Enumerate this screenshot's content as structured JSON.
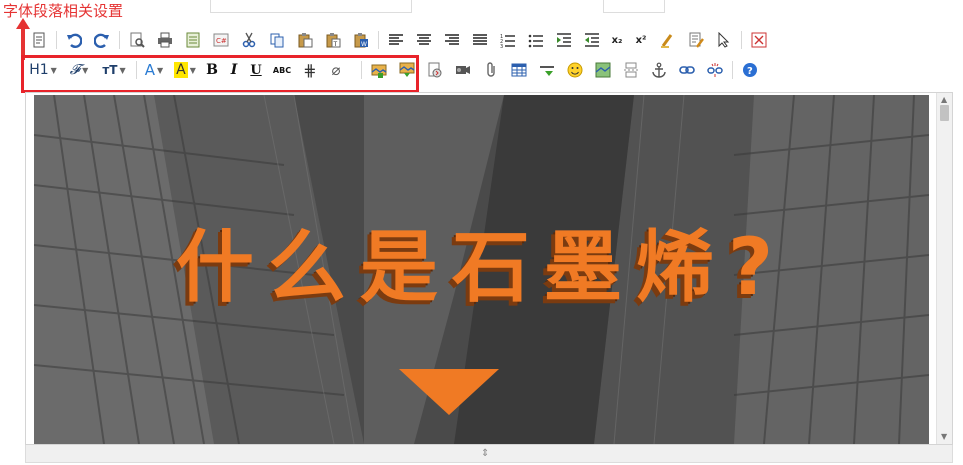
{
  "annotation": {
    "label": "字体段落相关设置",
    "color": "#e53333"
  },
  "toolbar": {
    "row1": [
      {
        "name": "source-icon",
        "title": "源代码"
      },
      {
        "name": "undo-icon",
        "title": "撤销"
      },
      {
        "name": "redo-icon",
        "title": "重做"
      },
      {
        "name": "preview-icon",
        "title": "预览"
      },
      {
        "name": "print-icon",
        "title": "打印"
      },
      {
        "name": "template-icon",
        "title": "模板"
      },
      {
        "name": "code-icon",
        "title": "插入代码"
      },
      {
        "name": "cut-icon",
        "title": "剪切"
      },
      {
        "name": "copy-icon",
        "title": "复制"
      },
      {
        "name": "paste-icon",
        "title": "粘贴"
      },
      {
        "name": "paste-text-icon",
        "title": "粘贴为纯文本"
      },
      {
        "name": "paste-word-icon",
        "title": "从Word粘贴"
      },
      {
        "name": "align-left-icon",
        "title": "左对齐"
      },
      {
        "name": "align-center-icon",
        "title": "居中"
      },
      {
        "name": "align-right-icon",
        "title": "右对齐"
      },
      {
        "name": "align-justify-icon",
        "title": "两端对齐"
      },
      {
        "name": "ordered-list-icon",
        "title": "编号"
      },
      {
        "name": "unordered-list-icon",
        "title": "项目符号"
      },
      {
        "name": "indent-icon",
        "title": "增加缩进"
      },
      {
        "name": "outdent-icon",
        "title": "减少缩进"
      },
      {
        "name": "subscript-icon",
        "title": "下标",
        "text": "x₂"
      },
      {
        "name": "superscript-icon",
        "title": "上标",
        "text": "x²"
      },
      {
        "name": "clear-format-icon",
        "title": "清除格式"
      },
      {
        "name": "quickformat-icon",
        "title": "一键排版"
      },
      {
        "name": "select-all-icon",
        "title": "全选"
      },
      {
        "name": "fullscreen-icon",
        "title": "全屏显示"
      }
    ],
    "row2_format": [
      {
        "name": "heading-button",
        "text": "H1"
      },
      {
        "name": "font-family-button",
        "text": "𝓕"
      },
      {
        "name": "font-size-button",
        "text": "тT"
      },
      {
        "name": "font-color-button",
        "text": "A"
      },
      {
        "name": "highlight-color-button",
        "text": "A"
      },
      {
        "name": "bold-button",
        "text": "B"
      },
      {
        "name": "italic-button",
        "text": "I"
      },
      {
        "name": "underline-button",
        "text": "U"
      },
      {
        "name": "strikethrough-button",
        "text": "ABC"
      },
      {
        "name": "line-height-button",
        "text": "⋕"
      },
      {
        "name": "remove-format-button",
        "text": "⌀"
      }
    ],
    "row2_insert": [
      {
        "name": "image-icon",
        "title": "图片"
      },
      {
        "name": "multi-image-icon",
        "title": "批量图片上传"
      },
      {
        "name": "flash-icon",
        "title": "Flash"
      },
      {
        "name": "media-icon",
        "title": "视音频"
      },
      {
        "name": "attachment-icon",
        "title": "插入文件"
      },
      {
        "name": "table-icon",
        "title": "表格"
      },
      {
        "name": "hr-icon",
        "title": "插入横线"
      },
      {
        "name": "emoticon-icon",
        "title": "插入表情"
      },
      {
        "name": "baidumap-icon",
        "title": "百度地图"
      },
      {
        "name": "pagebreak-icon",
        "title": "插入分页符"
      },
      {
        "name": "anchor-icon",
        "title": "锚点"
      },
      {
        "name": "link-icon",
        "title": "超级链接"
      },
      {
        "name": "unlink-icon",
        "title": "取消超级链接"
      },
      {
        "name": "help-icon",
        "title": "帮助"
      }
    ]
  },
  "content": {
    "title": "什么是石墨烯?",
    "accent": "#f07a24"
  }
}
